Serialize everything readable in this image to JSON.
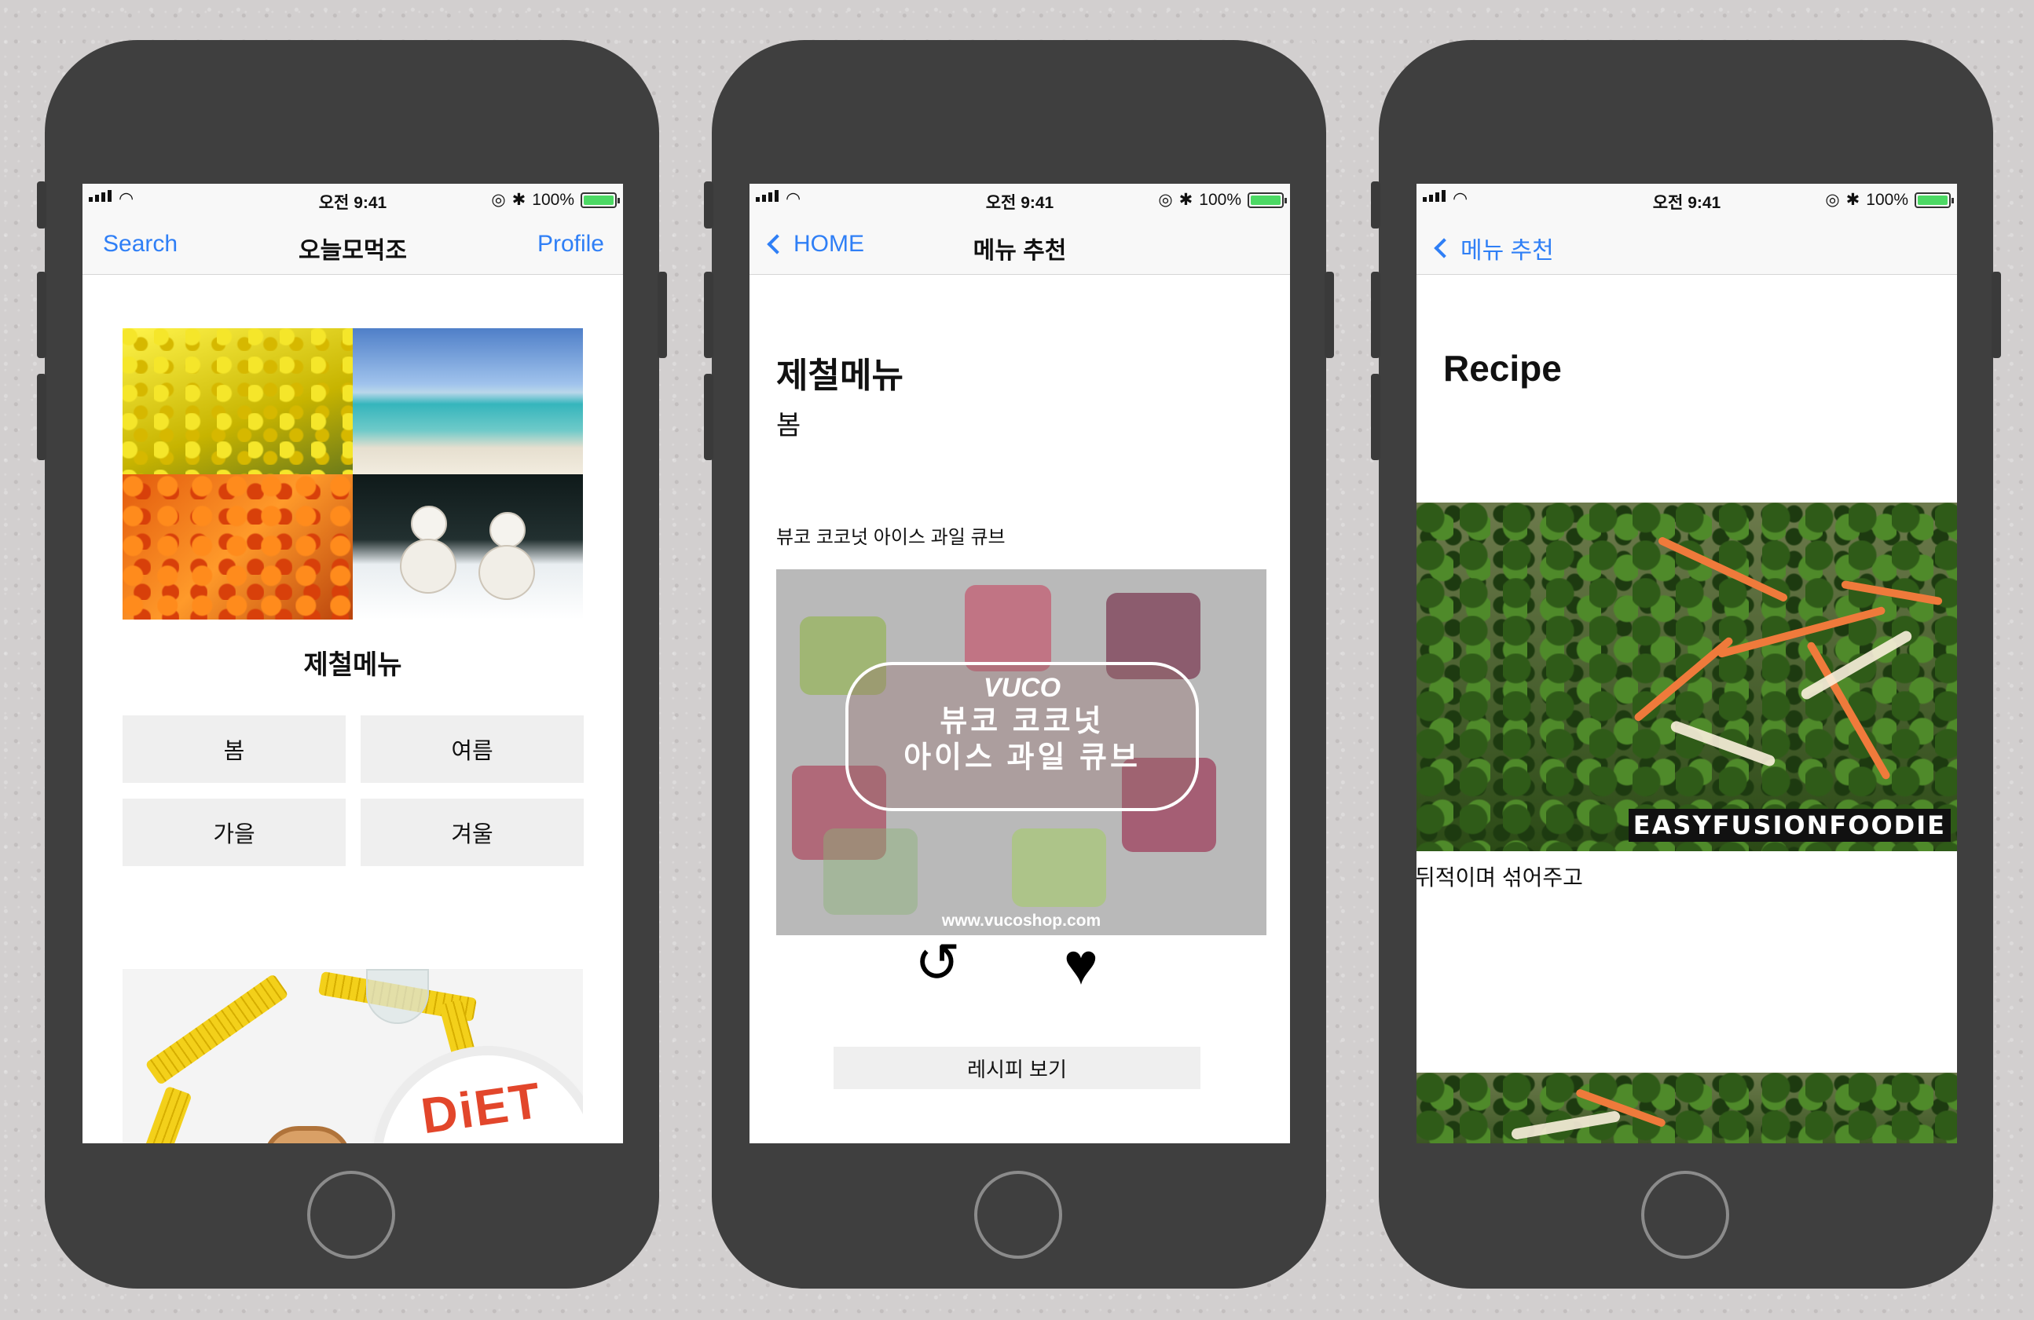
{
  "status_bar": {
    "time": "오전 9:41",
    "battery": "100%"
  },
  "screen1": {
    "nav": {
      "left": "Search",
      "title": "오늘모먹조",
      "right": "Profile"
    },
    "section_title": "제철메뉴",
    "season_buttons": [
      "봄",
      "여름",
      "가을",
      "겨울"
    ],
    "diet_word": "DiET"
  },
  "screen2": {
    "nav": {
      "back": "HOME",
      "title": "메뉴 추천"
    },
    "heading": "제철메뉴",
    "season": "봄",
    "menu_item": "뷰코 코코넛 아이스 과일 큐브",
    "photo": {
      "logo": "VUCO",
      "line1": "뷰코 코코넛",
      "line2": "아이스 과일 큐브",
      "url": "www.vucoshop.com"
    },
    "recipe_button": "레시피 보기"
  },
  "screen3": {
    "nav": {
      "back": "메뉴 추천"
    },
    "title": "Recipe",
    "watermark": "EASYFUSIONFOODIE",
    "step_text": "뒤적이며 섞어주고"
  }
}
